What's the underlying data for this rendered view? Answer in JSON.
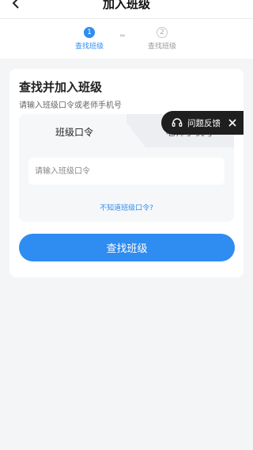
{
  "nav": {
    "title": "加入班级"
  },
  "steps": [
    {
      "num": "1",
      "label": "查找班级"
    },
    {
      "num": "2",
      "label": "查找班级"
    }
  ],
  "step_arrows": "▸▸",
  "card": {
    "heading": "查找并加入班级",
    "subheading": "请输入班级口令或老师手机号",
    "tabs": [
      {
        "label": "班级口令"
      },
      {
        "label": "老师手机号"
      }
    ],
    "input": {
      "placeholder": "请输入班级口令",
      "value": ""
    },
    "help_link": "不知道班级口令?",
    "button_label": "查找班级"
  },
  "feedback": {
    "label": "问题反馈"
  },
  "colors": {
    "accent": "#2f8cf0",
    "feedback_bg": "#1f1f1f"
  }
}
